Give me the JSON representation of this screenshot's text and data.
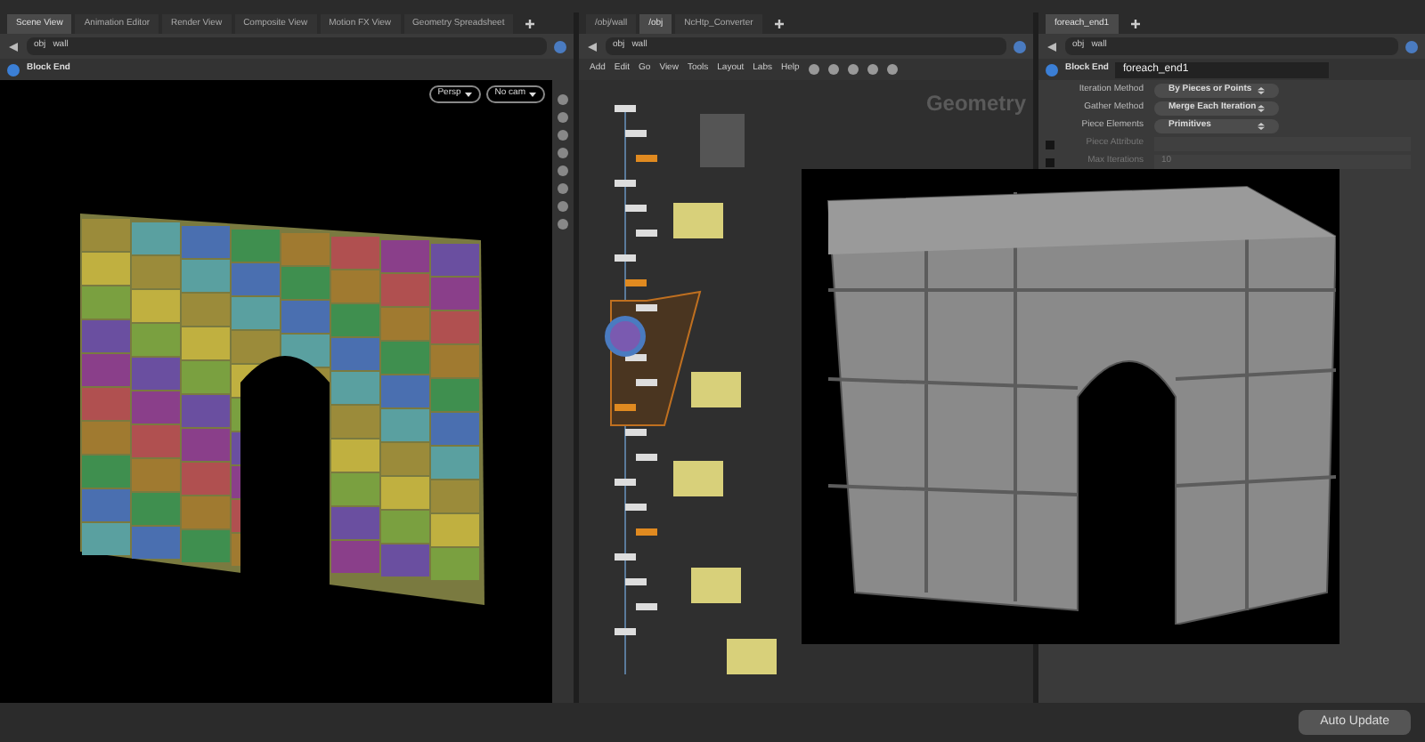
{
  "left_pane": {
    "tabs": [
      {
        "label": "Scene View",
        "selected": true
      },
      {
        "label": "Animation Editor",
        "selected": false
      },
      {
        "label": "Render View",
        "selected": false
      },
      {
        "label": "Composite View",
        "selected": false
      },
      {
        "label": "Motion FX View",
        "selected": false
      },
      {
        "label": "Geometry Spreadsheet",
        "selected": false
      }
    ],
    "path": [
      "obj",
      "wall"
    ],
    "title": "Block End",
    "camera_buttons": [
      "Persp",
      "No cam"
    ]
  },
  "network_pane": {
    "tabs": [
      {
        "label": "/obj/wall",
        "selected": false
      },
      {
        "label": "/obj",
        "selected": true
      },
      {
        "label": "NcHtp_Converter",
        "selected": false
      }
    ],
    "path": [
      "obj",
      "wall"
    ],
    "menu": [
      "Add",
      "Edit",
      "Go",
      "View",
      "Tools",
      "Layout",
      "Labs",
      "Help"
    ],
    "context_label": "Geometry"
  },
  "parameter_pane": {
    "tabs": [
      {
        "label": "foreach_end1",
        "selected": true
      }
    ],
    "path": [
      "obj",
      "wall"
    ],
    "node_type": "Block End",
    "node_name": "foreach_end1",
    "params": [
      {
        "kind": "menu",
        "label": "Iteration Method",
        "value": "By Pieces or Points",
        "disabled": false
      },
      {
        "kind": "menu",
        "label": "Gather Method",
        "value": "Merge Each Iteration",
        "disabled": false
      },
      {
        "kind": "menu",
        "label": "Piece Elements",
        "value": "Primitives",
        "disabled": false
      },
      {
        "kind": "text",
        "label": "Piece Attribute",
        "disabled": true,
        "checked": false
      },
      {
        "kind": "text",
        "label": "Max Iterations",
        "value": "10",
        "disabled": true,
        "checked": false
      }
    ]
  },
  "status_bar": {
    "button": "Auto Update"
  }
}
